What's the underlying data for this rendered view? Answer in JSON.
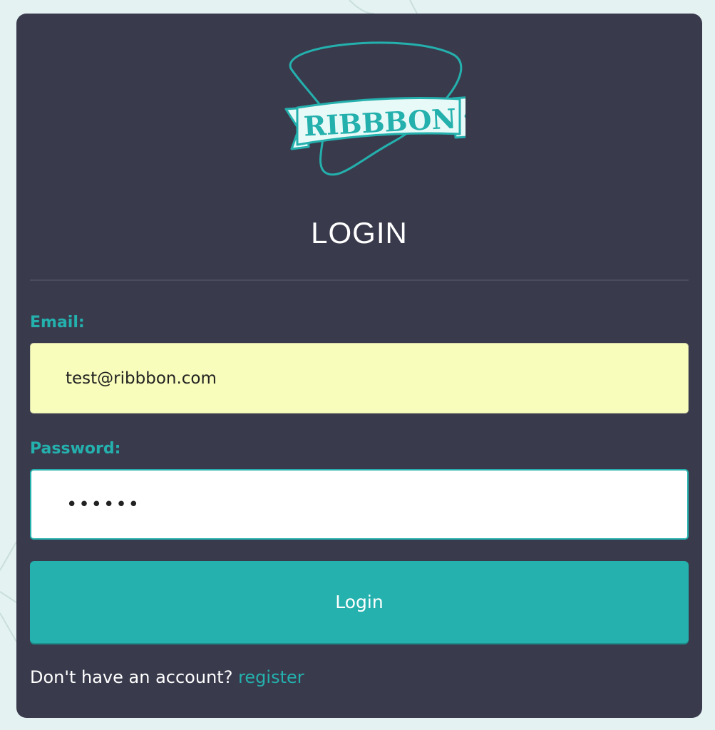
{
  "colors": {
    "page_background": "#e4f2f1",
    "card_background": "#393b4d",
    "accent": "#24b0ad",
    "email_field_background": "#f8fdbb",
    "password_field_background": "#ffffff",
    "button_background": "#25b1ae"
  },
  "logo": {
    "text": "RIBBBON",
    "icon": "ribbon-banner-logo"
  },
  "login": {
    "title": "LOGIN"
  },
  "form": {
    "email_label": "Email:",
    "email_value": "test@ribbbon.com",
    "password_label": "Password:",
    "password_value": "••••••",
    "submit_label": "Login"
  },
  "footer": {
    "prompt": "Don't have an account?",
    "register_link": "register"
  }
}
